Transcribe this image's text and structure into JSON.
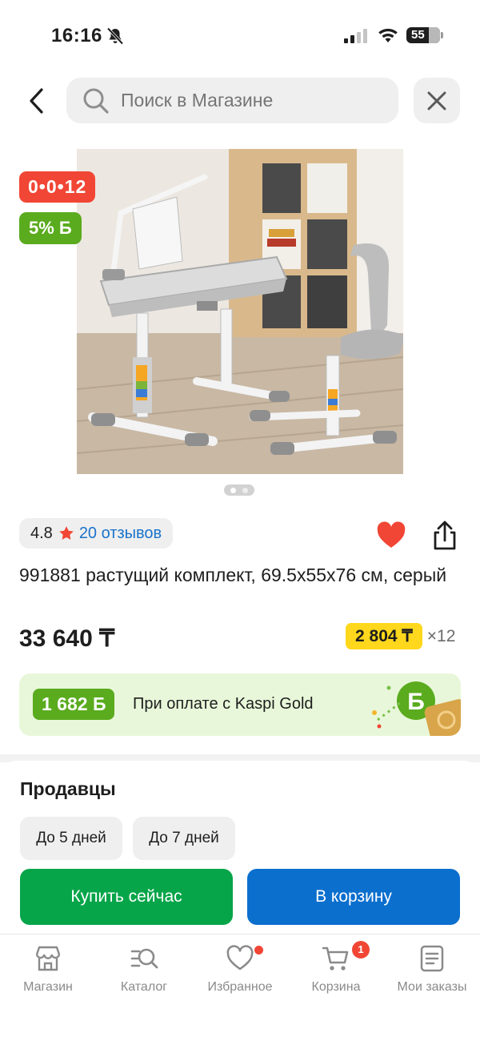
{
  "status_bar": {
    "time": "16:16",
    "battery": "55",
    "icons": [
      "bell-slash-icon",
      "signal-icon",
      "wifi-icon",
      "battery-icon"
    ]
  },
  "header": {
    "search_placeholder": "Поиск в Магазине",
    "icons": [
      "chevron-left-icon",
      "search-icon",
      "close-icon"
    ]
  },
  "gallery": {
    "timer": "0•0•12",
    "bonus_badge": "5% Б",
    "image_count": 2,
    "active_image": 1
  },
  "product": {
    "rating": "4.8",
    "reviews_label": "20 отзывов",
    "favorite": true,
    "title": "991881 растущий комплект, 69.5x55x76 см, серый",
    "price": "33 640 ₸",
    "installment_amount": "2 804 ₸",
    "installment_term": "×12"
  },
  "kaspi_gold": {
    "bonus": "1 682 Б",
    "text": "При оплате с Kaspi Gold"
  },
  "sellers": {
    "title": "Продавцы",
    "chips": [
      "До 5 дней",
      "До 7 дней"
    ],
    "buy_now": "Купить сейчас",
    "add_to_cart": "В корзину"
  },
  "tabbar": {
    "items": [
      {
        "label": "Магазин",
        "icon": "store-icon"
      },
      {
        "label": "Каталог",
        "icon": "catalog-search-icon"
      },
      {
        "label": "Избранное",
        "icon": "heart-outline-icon",
        "has_dot": true
      },
      {
        "label": "Корзина",
        "icon": "cart-icon",
        "badge": "1"
      },
      {
        "label": "Мои заказы",
        "icon": "orders-list-icon"
      }
    ]
  },
  "colors": {
    "accent_red": "#f14635",
    "bonus_green": "#5aab1e",
    "buy_green": "#07a54a",
    "cart_blue": "#0b6fce",
    "installment_yellow": "#ffd71c",
    "link_blue": "#1a73c9"
  }
}
